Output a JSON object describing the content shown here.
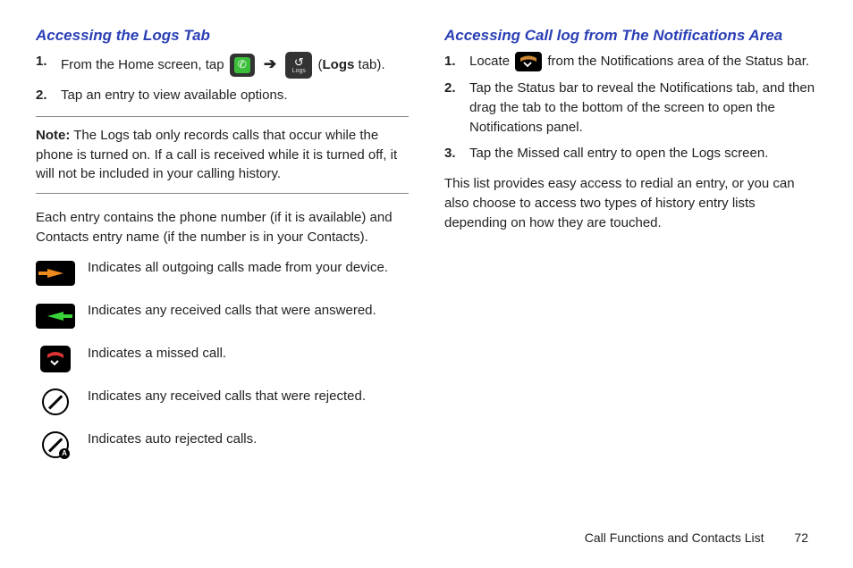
{
  "left": {
    "heading": "Accessing the Logs Tab",
    "steps": [
      {
        "num": "1.",
        "pre": "From the Home screen, tap ",
        "post_open": " (",
        "post_bold": "Logs",
        "post_close": " tab)."
      },
      {
        "num": "2.",
        "text": "Tap an entry to view available options."
      }
    ],
    "note_label": "Note:",
    "note_text": " The Logs tab only records calls that occur while the phone is turned on. If a call is received while it is turned off, it will not be included in your calling history.",
    "para": "Each entry contains the phone number (if it is available) and Contacts entry name (if the number is in your Contacts).",
    "legend": [
      "Indicates all outgoing calls made from your device.",
      "Indicates any received calls that were answered.",
      "Indicates a missed call.",
      "Indicates any received calls that were rejected.",
      "Indicates auto rejected calls."
    ]
  },
  "right": {
    "heading": "Accessing Call log from The Notifications Area",
    "steps": [
      {
        "num": "1.",
        "pre": "Locate ",
        "post": " from the Notifications area of the Status bar."
      },
      {
        "num": "2.",
        "text": "Tap the Status bar to reveal the Notifications tab, and then drag the tab to the bottom of the screen to open the Notifications panel."
      },
      {
        "num": "3.",
        "text": "Tap the Missed call entry to open the Logs screen."
      }
    ],
    "para": "This list provides easy access to redial an entry, or you can also choose to access two types of history entry lists depending on how they are touched."
  },
  "footer": {
    "section": "Call Functions and Contacts List",
    "page": "72"
  },
  "glyphs": {
    "arrow": "➔",
    "phone": "✆",
    "missed": "✕",
    "logs_top": "↺",
    "logs_label": "Logs",
    "auto_sub": "A"
  }
}
